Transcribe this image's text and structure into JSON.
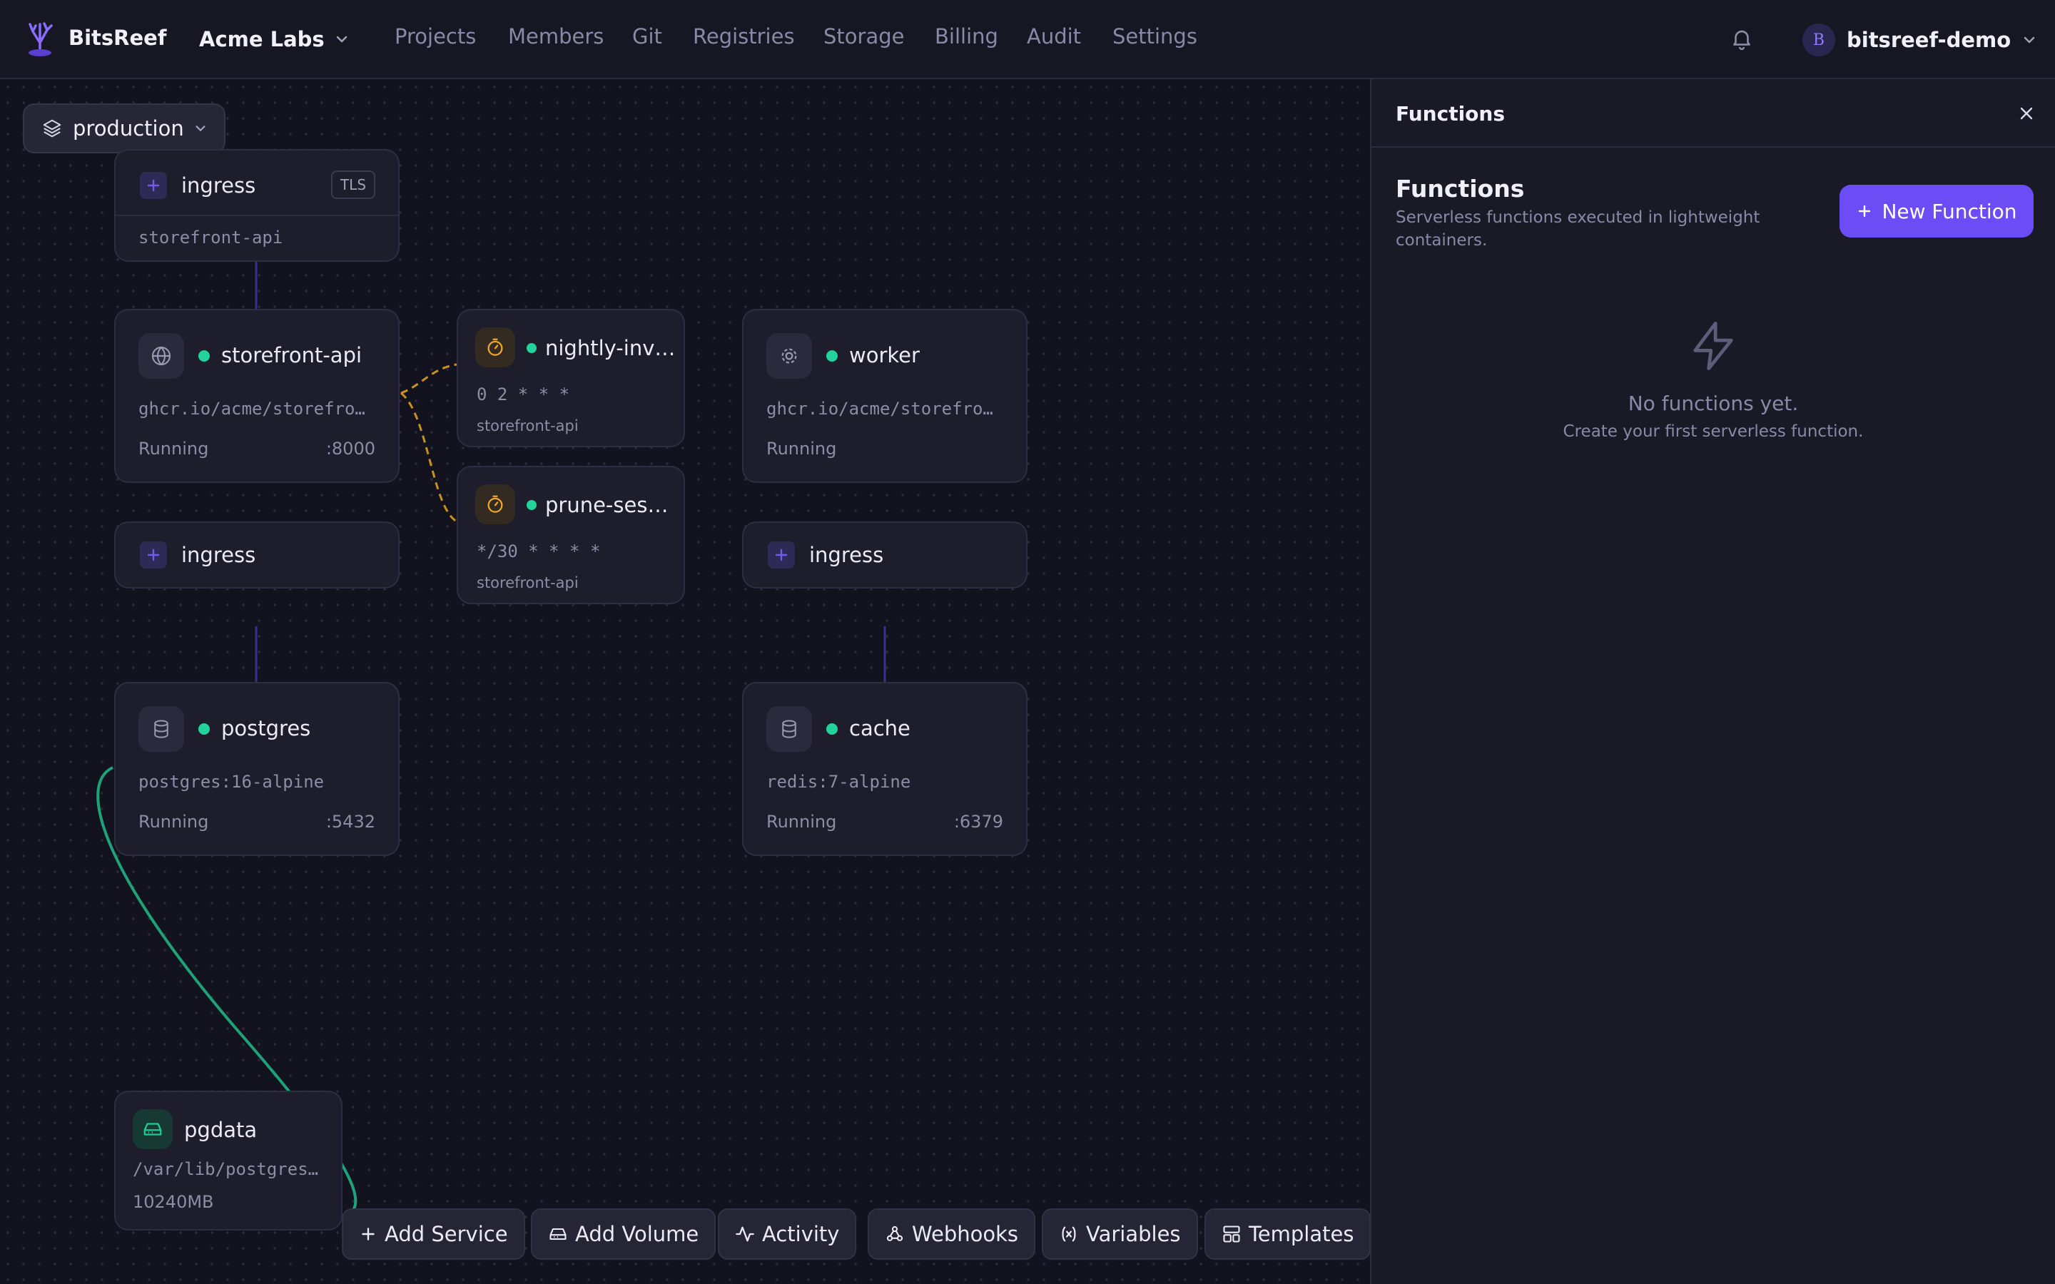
{
  "app": {
    "name": "BitsReef"
  },
  "org": {
    "name": "Acme Labs"
  },
  "nav": {
    "items": [
      "Projects",
      "Members",
      "Git",
      "Registries",
      "Storage",
      "Billing",
      "Audit",
      "Settings"
    ]
  },
  "user": {
    "initial": "B",
    "name": "bitsreef-demo"
  },
  "env": {
    "name": "production"
  },
  "cards": {
    "ingress_top": {
      "title": "ingress",
      "badge": "TLS",
      "target": "storefront-api"
    },
    "storefront": {
      "title": "storefront-api",
      "image": "ghcr.io/acme/storefro…",
      "status": "Running",
      "port": ":8000"
    },
    "nightly": {
      "title": "nightly-inv…",
      "cron": "0 2 * * *",
      "target": "storefront-api"
    },
    "prune": {
      "title": "prune-ses…",
      "cron": "*/30 * * * *",
      "target": "storefront-api"
    },
    "worker": {
      "title": "worker",
      "image": "ghcr.io/acme/storefro…",
      "status": "Running"
    },
    "ingress_left": {
      "title": "ingress"
    },
    "ingress_right": {
      "title": "ingress"
    },
    "postgres": {
      "title": "postgres",
      "image": "postgres:16-alpine",
      "status": "Running",
      "port": ":5432"
    },
    "cache": {
      "title": "cache",
      "image": "redis:7-alpine",
      "status": "Running",
      "port": ":6379"
    },
    "pgdata": {
      "title": "pgdata",
      "path": "/var/lib/postgres…",
      "size": "10240MB"
    }
  },
  "toolbar": {
    "add_service": "Add Service",
    "add_volume": "Add Volume",
    "activity": "Activity",
    "webhooks": "Webhooks",
    "variables": "Variables",
    "templates": "Templates"
  },
  "panel": {
    "header": "Functions",
    "title": "Functions",
    "description": "Serverless functions executed in lightweight containers.",
    "new_button": "New Function",
    "empty_title": "No functions yet.",
    "empty_subtitle": "Create your first serverless function."
  },
  "colors": {
    "accent": "#6c4cf5",
    "status_running": "#22d39a",
    "cron_edge": "#c8921c",
    "volume_edge": "#1ea379",
    "link_edge": "#3b2f8f"
  },
  "icons": {
    "logo": "reef-logo-icon",
    "bell": "bell-icon",
    "layers": "layers-icon",
    "globe": "globe-icon",
    "timer": "timer-icon",
    "gear": "gear-icon",
    "database": "database-icon",
    "drive": "hard-drive-icon",
    "bolt": "lightning-icon",
    "close": "close-icon"
  }
}
